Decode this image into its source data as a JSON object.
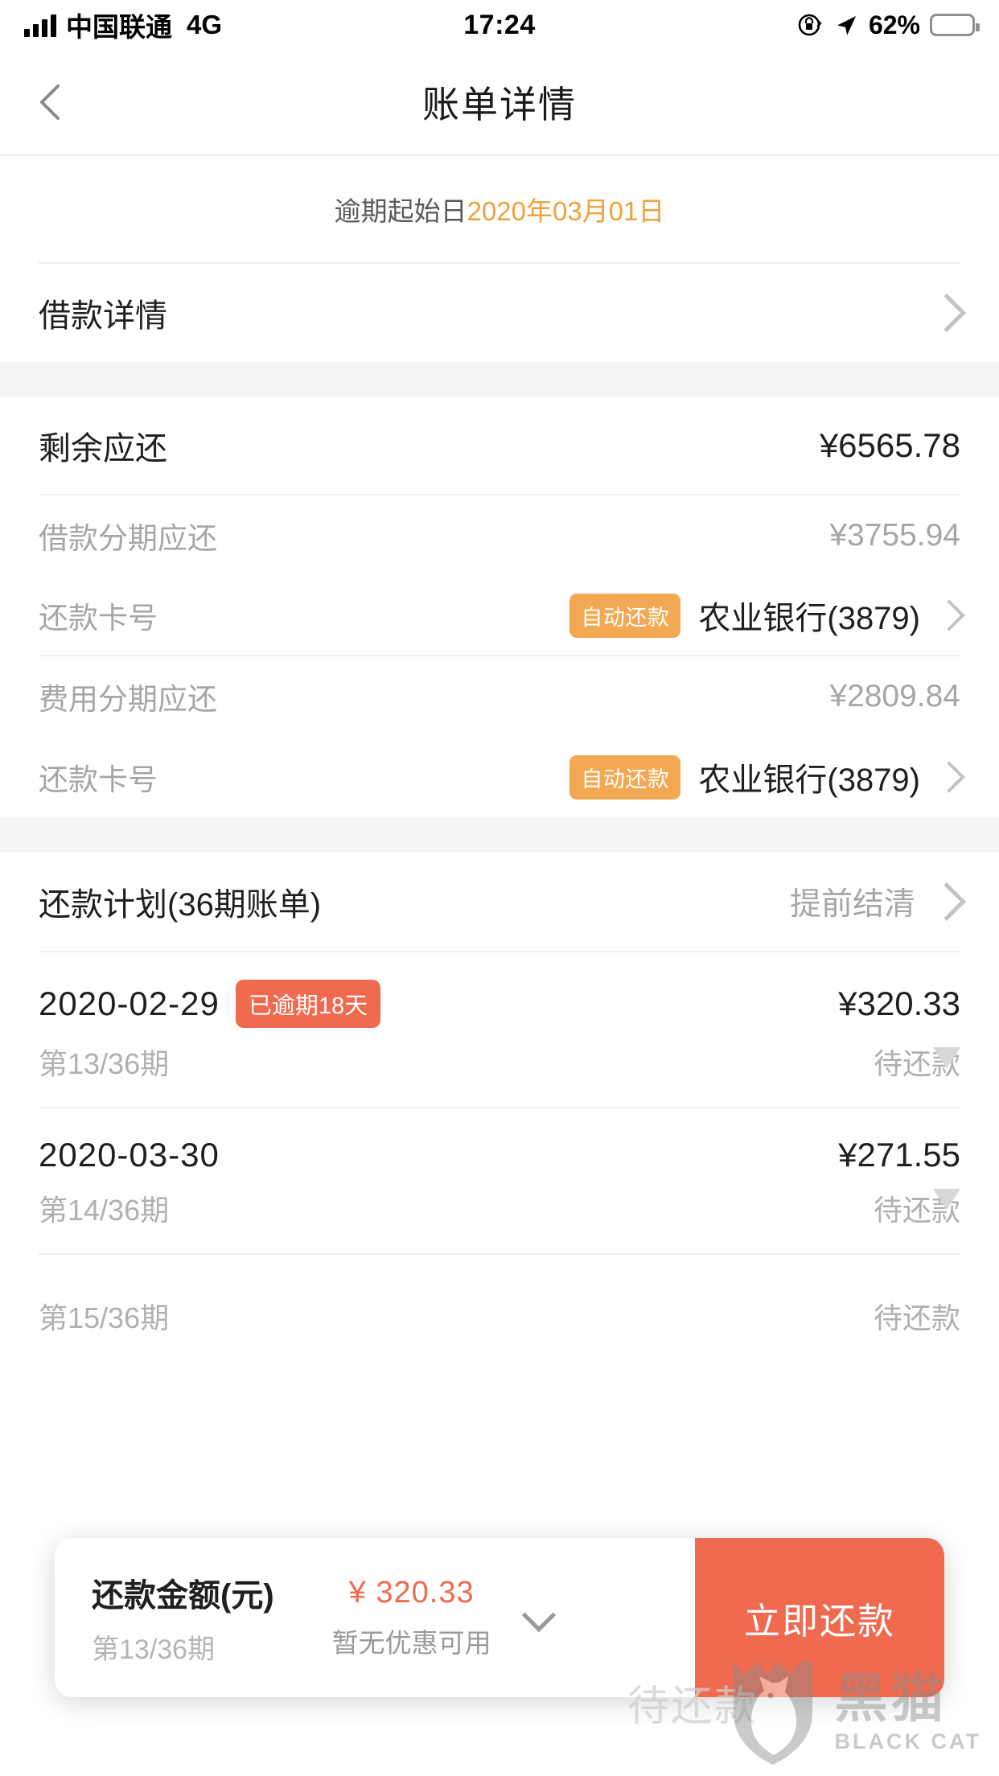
{
  "status_bar": {
    "carrier": "中国联通",
    "network": "4G",
    "time": "17:24",
    "battery_percent": "62%",
    "battery_level": 62,
    "icons": [
      "signal-bars-icon",
      "rotation-lock-icon",
      "location-arrow-icon",
      "battery-icon"
    ]
  },
  "nav": {
    "back_icon": "chevron-left-icon",
    "title": "账单详情"
  },
  "notice": {
    "label": "逾期起始日",
    "date": "2020年03月01日",
    "date_color": "#f0a03c"
  },
  "loan_detail_row": {
    "label": "借款详情",
    "chevron": "chevron-right-icon"
  },
  "summary": {
    "remaining_label": "剩余应还",
    "remaining_value": "¥6565.78",
    "groups": [
      {
        "amount_label": "借款分期应还",
        "amount_value": "¥3755.94",
        "card_label": "还款卡号",
        "auto_badge": "自动还款",
        "bank": "农业银行(3879)"
      },
      {
        "amount_label": "费用分期应还",
        "amount_value": "¥2809.84",
        "card_label": "还款卡号",
        "auto_badge": "自动还款",
        "bank": "农业银行(3879)"
      }
    ]
  },
  "plan": {
    "title": "还款计划(36期账单)",
    "action_label": "提前结清",
    "items": [
      {
        "date": "2020-02-29",
        "overdue_badge": "已逾期18天",
        "amount": "¥320.33",
        "term": "第13/36期",
        "status": "待还款"
      },
      {
        "date": "2020-03-30",
        "overdue_badge": "",
        "amount": "¥271.55",
        "term": "第14/36期",
        "status": "待还款"
      },
      {
        "date": "",
        "overdue_badge": "",
        "amount": "",
        "term": "第15/36期",
        "status": "待还款"
      }
    ]
  },
  "action_bar": {
    "title": "还款金额(元)",
    "subtitle": "第13/36期",
    "amount": "¥ 320.33",
    "promo_text": "暂无优惠可用",
    "expand_icon": "chevron-down-icon",
    "button_label": "立即还款"
  },
  "watermark": {
    "cn": "黑猫",
    "en": "BLACK CAT",
    "ghost_text": "待还款"
  },
  "colors": {
    "accent_orange": "#f0a03c",
    "badge_orange": "#f3a953",
    "accent_red": "#ef6a4f",
    "page_bg": "#f4f5f7",
    "battery_yellow": "#f7cf46"
  }
}
